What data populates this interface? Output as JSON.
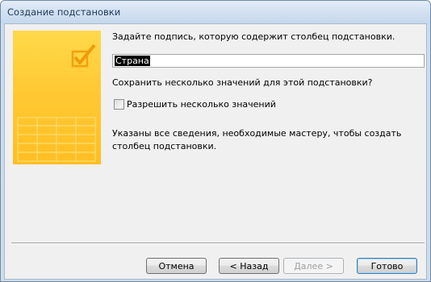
{
  "window": {
    "title": "Создание подстановки"
  },
  "prompt": "Задайте подпись, которую содержит столбец подстановки.",
  "caption_input": {
    "value": "Страна"
  },
  "question": "Сохранить несколько значений для этой подстановки?",
  "checkbox": {
    "label": "Разрешить несколько значений",
    "checked": false
  },
  "info": "Указаны все сведения, необходимые мастеру, чтобы создать столбец подстановки.",
  "buttons": {
    "cancel": "Отмена",
    "back": "< Назад",
    "next": "Далее >",
    "finish": "Готово"
  },
  "colors": {
    "panel": "#ffc934",
    "title_text": "#1e395b"
  },
  "icons": {
    "panel_graphic": "check-table-icon"
  }
}
